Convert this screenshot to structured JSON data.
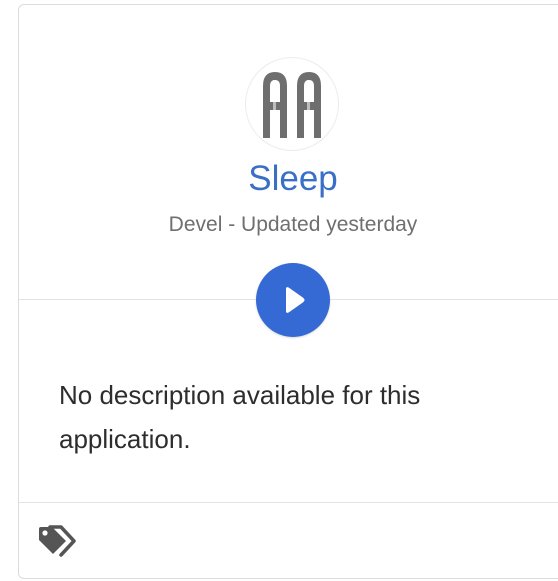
{
  "app": {
    "name": "Sleep",
    "meta": "Devel - Updated yesterday",
    "logo_icon": "aa-monogram-logo",
    "description": "No description available for this application."
  },
  "icons": {
    "play": "play-icon",
    "tags": "tags-icon"
  },
  "colors": {
    "accent": "#3569d4",
    "title": "#3a6fc8",
    "meta_text": "#6f6f6f",
    "icon_gray": "#555555"
  }
}
